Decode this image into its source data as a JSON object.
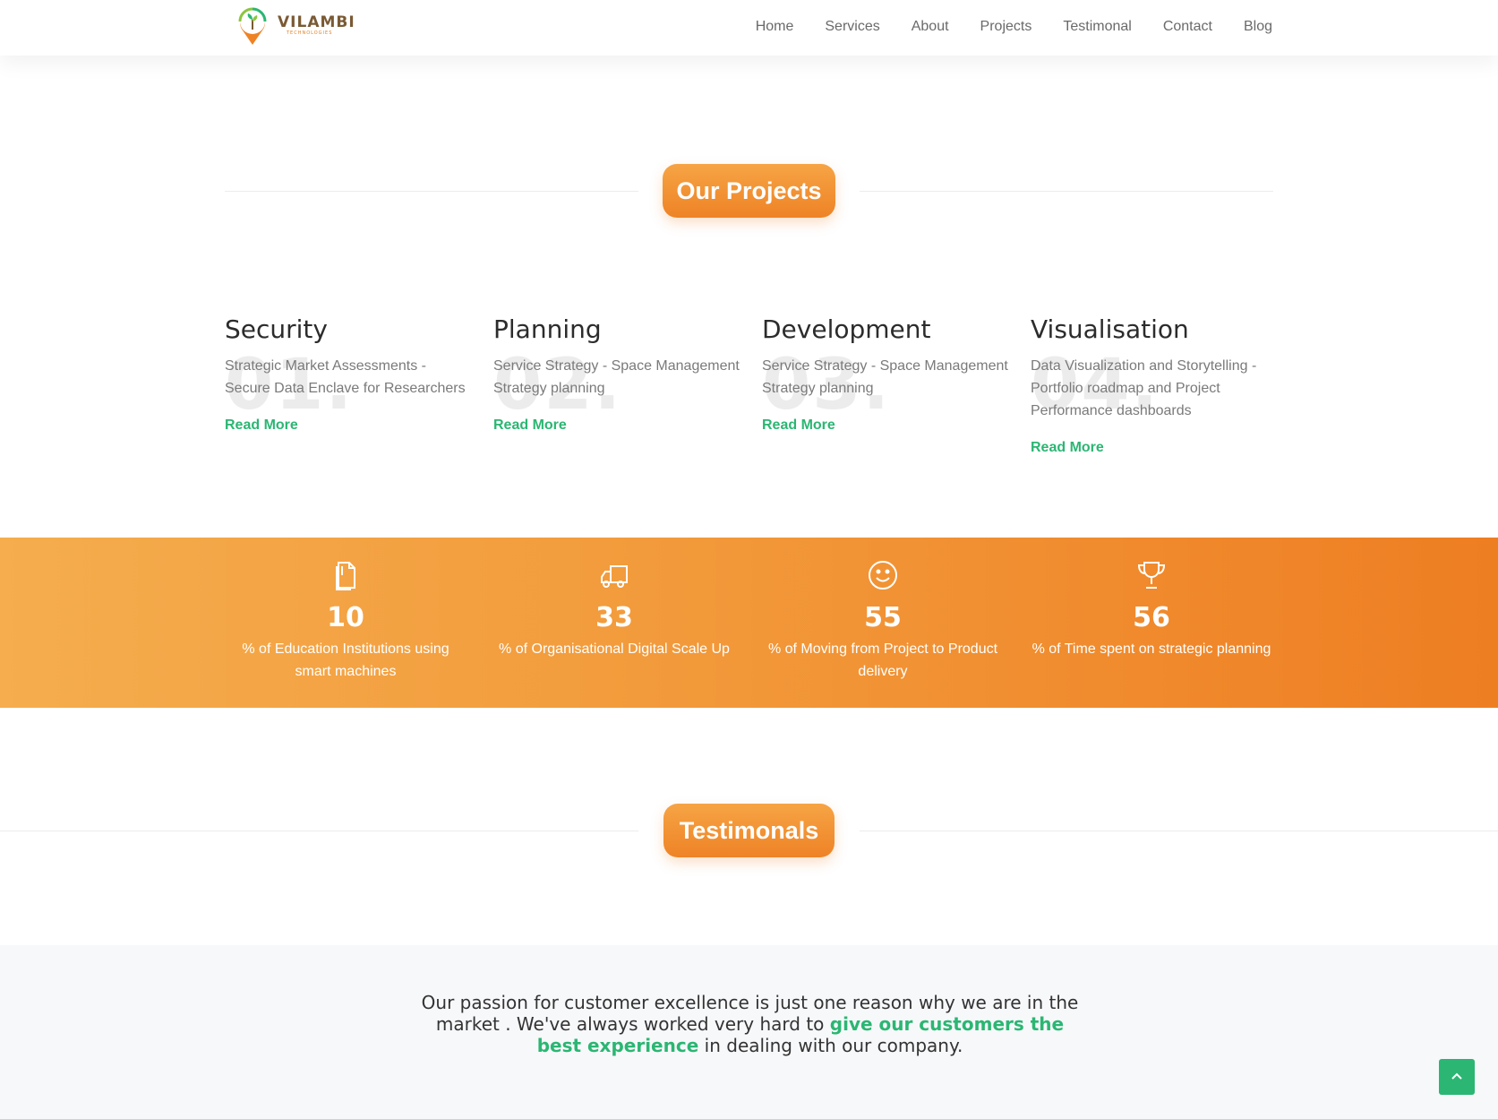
{
  "header": {
    "logo": {
      "name": "VILAMBI",
      "sub": "TECHNOLOGIES"
    },
    "nav": [
      {
        "label": "Home"
      },
      {
        "label": "Services"
      },
      {
        "label": "About"
      },
      {
        "label": "Projects"
      },
      {
        "label": "Testimonal"
      },
      {
        "label": "Contact"
      },
      {
        "label": "Blog"
      }
    ]
  },
  "projects_section": {
    "title": "Our Projects",
    "items": [
      {
        "number": "01.",
        "title": "Security",
        "description": "Strategic Market Assessments - Secure Data Enclave for Researchers",
        "link": "Read More"
      },
      {
        "number": "02.",
        "title": "Planning",
        "description": "Service Strategy - Space Management Strategy planning",
        "link": "Read More"
      },
      {
        "number": "03.",
        "title": "Development",
        "description": "Service Strategy - Space Management Strategy planning",
        "link": "Read More"
      },
      {
        "number": "04.",
        "title": "Visualisation",
        "description": "Data Visualization and Storytelling - Portfolio roadmap and Project Performance dashboards",
        "link": "Read More"
      }
    ]
  },
  "stats": [
    {
      "icon": "document-icon",
      "value": "10",
      "label": "% of Education Institutions using smart machines"
    },
    {
      "icon": "truck-icon",
      "value": "33",
      "label": "% of Organisational Digital Scale Up"
    },
    {
      "icon": "smiley-icon",
      "value": "55",
      "label": "% of Moving from Project to Product delivery"
    },
    {
      "icon": "trophy-icon",
      "value": "56",
      "label": "% of Time spent on strategic planning"
    }
  ],
  "testimonials_section": {
    "title": "Testimonals",
    "quote_before": "Our passion for customer excellence is just one reason why we are in the market . We've always worked very hard to ",
    "quote_highlight": "give our customers the best experience",
    "quote_after": " in dealing with our company."
  },
  "colors": {
    "accent_orange": "#ee8326",
    "accent_green": "#2bb673"
  }
}
